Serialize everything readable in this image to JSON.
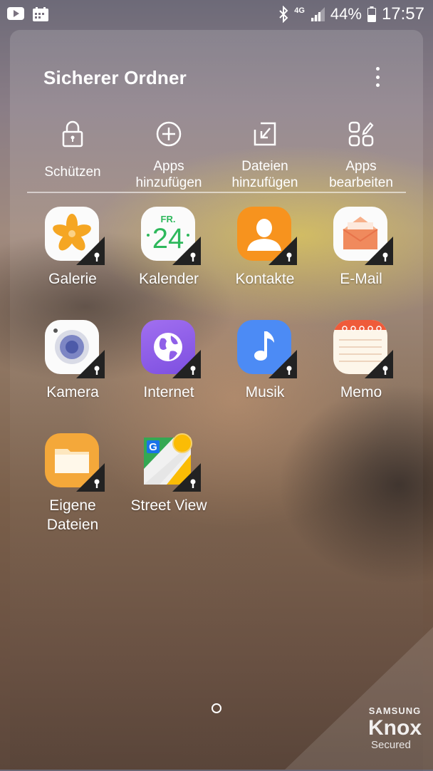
{
  "status_bar": {
    "network": "4G",
    "battery": "44%",
    "time": "17:57",
    "icons": [
      "youtube-icon",
      "calendar-icon",
      "bluetooth-icon",
      "signal-icon",
      "battery-icon"
    ]
  },
  "folder": {
    "title": "Sicherer Ordner",
    "actions": [
      {
        "line1": "Schützen",
        "line2": "",
        "icon": "lock-icon"
      },
      {
        "line1": "Apps",
        "line2": "hinzufügen",
        "icon": "add-circle-icon"
      },
      {
        "line1": "Dateien",
        "line2": "hinzufügen",
        "icon": "add-file-icon"
      },
      {
        "line1": "Apps",
        "line2": "bearbeiten",
        "icon": "edit-apps-icon"
      }
    ]
  },
  "apps": [
    {
      "line1": "Galerie",
      "line2": "",
      "icon": "gallery-icon"
    },
    {
      "line1": "Kalender",
      "line2": "",
      "icon": "calendar-app-icon",
      "day_label": "FR.",
      "day_number": "24"
    },
    {
      "line1": "Kontakte",
      "line2": "",
      "icon": "contacts-icon"
    },
    {
      "line1": "E-Mail",
      "line2": "",
      "icon": "email-icon"
    },
    {
      "line1": "Kamera",
      "line2": "",
      "icon": "camera-icon"
    },
    {
      "line1": "Internet",
      "line2": "",
      "icon": "internet-icon"
    },
    {
      "line1": "Musik",
      "line2": "",
      "icon": "music-icon"
    },
    {
      "line1": "Memo",
      "line2": "",
      "icon": "memo-icon"
    },
    {
      "line1": "Eigene",
      "line2": "Dateien",
      "icon": "my-files-icon"
    },
    {
      "line1": "Street View",
      "line2": "",
      "icon": "street-view-icon"
    }
  ],
  "knox": {
    "brand": "SAMSUNG",
    "name": "Knox",
    "subtitle": "Secured"
  },
  "colors": {
    "gallery": "#f5a623",
    "calendar_number": "#2eb85c",
    "contacts": "#f7931e",
    "email": "#f08a5d",
    "internet": "#8f5fe8",
    "music": "#4c8bf5",
    "memo_accent": "#ef5b3a",
    "files": "#f4a83a"
  }
}
